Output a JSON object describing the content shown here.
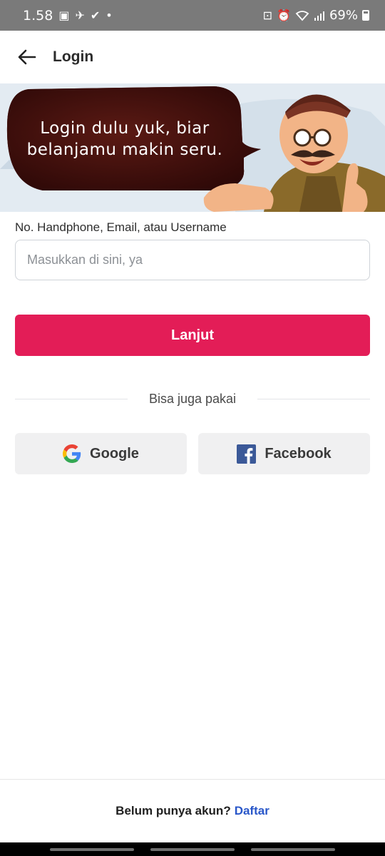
{
  "status_bar": {
    "time": "1.58",
    "battery": "69%"
  },
  "app_bar": {
    "title": "Login"
  },
  "banner": {
    "text_line1": "Login dulu yuk, biar",
    "text_line2": "belanjamu makin seru."
  },
  "form": {
    "field_label": "No. Handphone, Email, atau Username",
    "input_placeholder": "Masukkan di sini, ya",
    "input_value": "",
    "submit_label": "Lanjut"
  },
  "alt_login": {
    "divider_text": "Bisa juga pakai",
    "google_label": "Google",
    "facebook_label": "Facebook"
  },
  "footer": {
    "prompt": "Belum punya akun?",
    "link": "Daftar"
  },
  "colors": {
    "primary": "#e31d57",
    "link": "#2957c9",
    "facebook": "#3b5998"
  }
}
